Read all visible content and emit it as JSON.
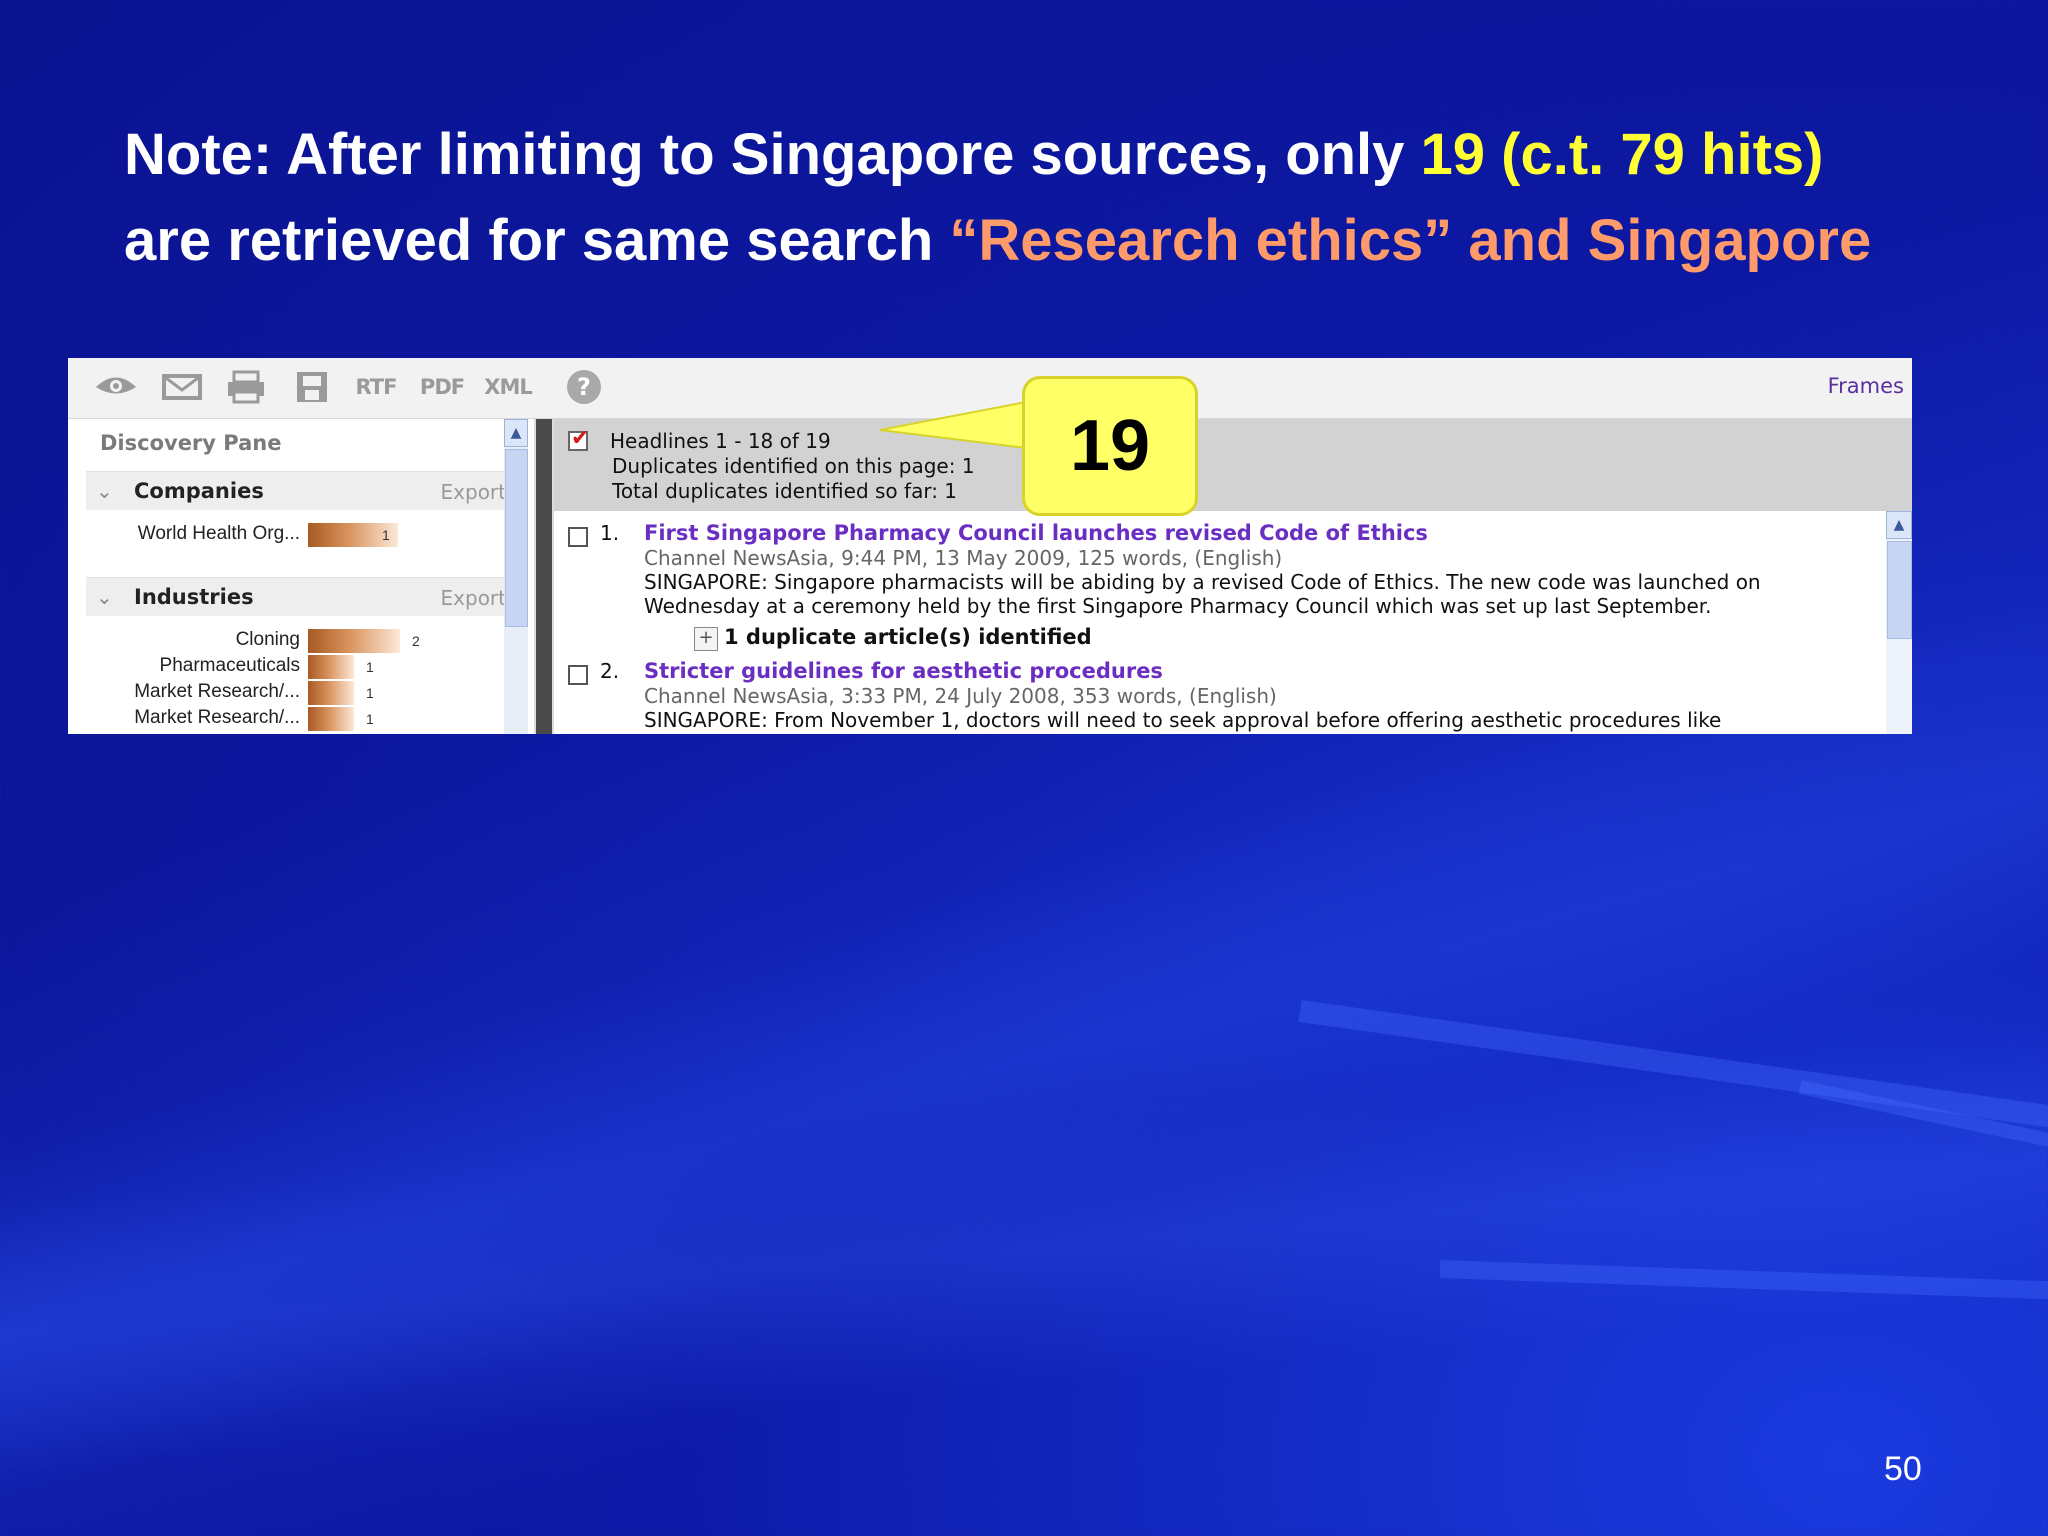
{
  "slide": {
    "title_part1": "Note: After limiting to Singapore sources, only ",
    "title_highlight_yellow": "19 (c.t. 79 hits)",
    "title_part2": "are retrieved for same search ",
    "title_highlight_orange": "“Research ethics” and Singapore",
    "page_number": "50",
    "colors": {
      "background": "#0d1aa8",
      "title": "#ffffff",
      "yellow": "#ffff33",
      "orange": "#ff9a6b"
    }
  },
  "toolbar": {
    "icons": [
      "eye-icon",
      "email-icon",
      "print-icon",
      "save-icon"
    ],
    "rtf_label": "RTF",
    "pdf_label": "PDF",
    "xml_label": "XML",
    "help_label": "?",
    "frames_link": "Frames"
  },
  "discovery": {
    "title": "Discovery Pane",
    "companies": {
      "label": "Companies",
      "export": "Export",
      "items": [
        {
          "label": "World Health Org...",
          "count": "1"
        }
      ]
    },
    "industries": {
      "label": "Industries",
      "export": "Export",
      "items": [
        {
          "label": "Cloning",
          "count": "2"
        },
        {
          "label": "Pharmaceuticals",
          "count": "1"
        },
        {
          "label": "Market Research/...",
          "count": "1"
        },
        {
          "label": "Market Research/...",
          "count": "1"
        }
      ]
    }
  },
  "results_header": {
    "headlines": "Headlines 1 - 18 of 19",
    "duplicates_page": "Duplicates identified on this page: 1",
    "duplicates_total": "Total duplicates identified so far: 1"
  },
  "callout": {
    "value": "19"
  },
  "results": [
    {
      "number": "1.",
      "title": "First Singapore Pharmacy Council launches revised Code of Ethics",
      "meta": "Channel NewsAsia, 9:44 PM, 13 May 2009, 125 words, (English)",
      "snippet_line1": "SINGAPORE: Singapore pharmacists will be abiding by a revised Code of Ethics. The new code was launched on",
      "snippet_line2": "Wednesday at a ceremony held by the first Singapore Pharmacy Council which was set up last September.",
      "duplicate_note": "1 duplicate article(s) identified"
    },
    {
      "number": "2.",
      "title": "Stricter guidelines for aesthetic procedures",
      "meta": "Channel NewsAsia, 3:33 PM, 24 July 2008, 353 words, (English)",
      "snippet_line1": "SINGAPORE: From November 1, doctors will need to seek approval before offering aesthetic procedures like"
    }
  ]
}
